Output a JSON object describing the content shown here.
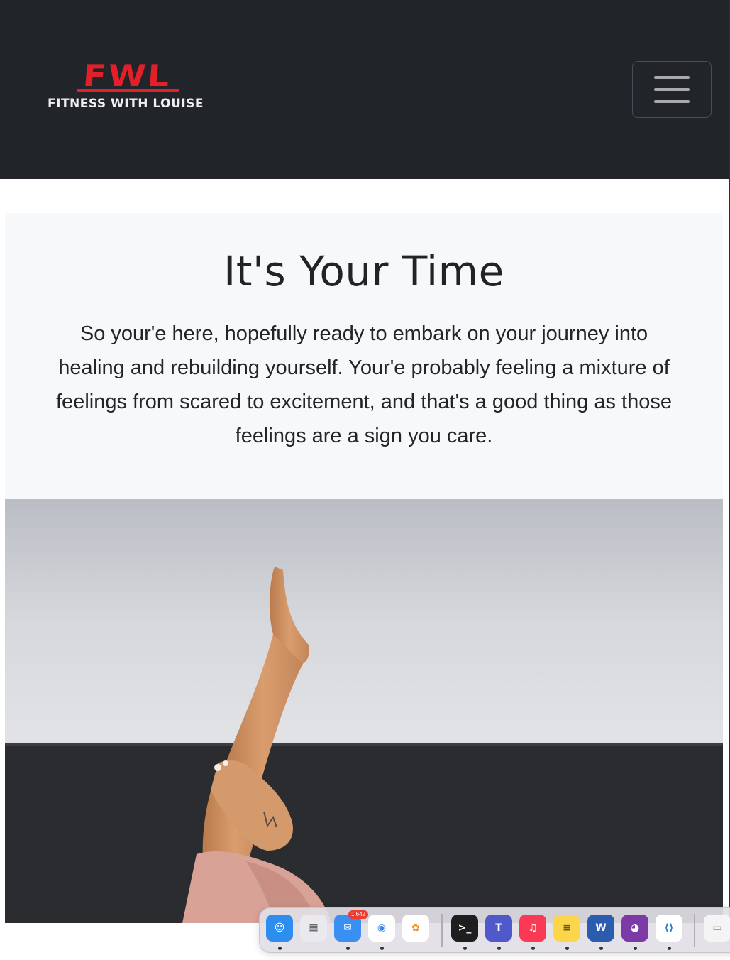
{
  "navbar": {
    "logo_mark": "FWL",
    "logo_subtitle": "FITNESS WITH LOUISE",
    "menu_button_icon": "hamburger-menu-icon"
  },
  "hero": {
    "title": "It's Your Time",
    "body": "So your'e here, hopefully ready to embark on your journey into healing and rebuilding yourself. Your'e probably feeling a mixture of feelings from scared to excitement, and that's a good thing as those feelings are a sign you care."
  },
  "dock": {
    "apps": [
      {
        "name": "finder",
        "icon": "finder-icon",
        "color": "#2e8ef0",
        "running": true
      },
      {
        "name": "launchpad",
        "icon": "launchpad-icon",
        "color": "#e9e9ee",
        "running": false
      },
      {
        "name": "mail",
        "icon": "mail-icon",
        "color": "#3a8ff2",
        "running": true,
        "badge": "1,642"
      },
      {
        "name": "chrome",
        "icon": "chrome-icon",
        "color": "#ffffff",
        "running": true
      },
      {
        "name": "photos",
        "icon": "photos-icon",
        "color": "#ffffff",
        "running": false
      },
      {
        "name": "terminal",
        "icon": "terminal-icon",
        "color": "#1e1e1e",
        "running": true
      },
      {
        "name": "teams",
        "icon": "teams-icon",
        "color": "#5059c9",
        "running": true
      },
      {
        "name": "music",
        "icon": "music-icon",
        "color": "#fa3a55",
        "running": true
      },
      {
        "name": "notes",
        "icon": "notes-icon",
        "color": "#fbd54a",
        "running": true
      },
      {
        "name": "word",
        "icon": "word-icon",
        "color": "#2b5cae",
        "running": true
      },
      {
        "name": "github-desktop",
        "icon": "github-icon",
        "color": "#7c3aa6",
        "running": true
      },
      {
        "name": "vscode",
        "icon": "vscode-icon",
        "color": "#ffffff",
        "running": true
      },
      {
        "name": "preview-window",
        "icon": "window-thumbnail-icon",
        "color": "#f4f4f4",
        "running": false
      }
    ]
  }
}
